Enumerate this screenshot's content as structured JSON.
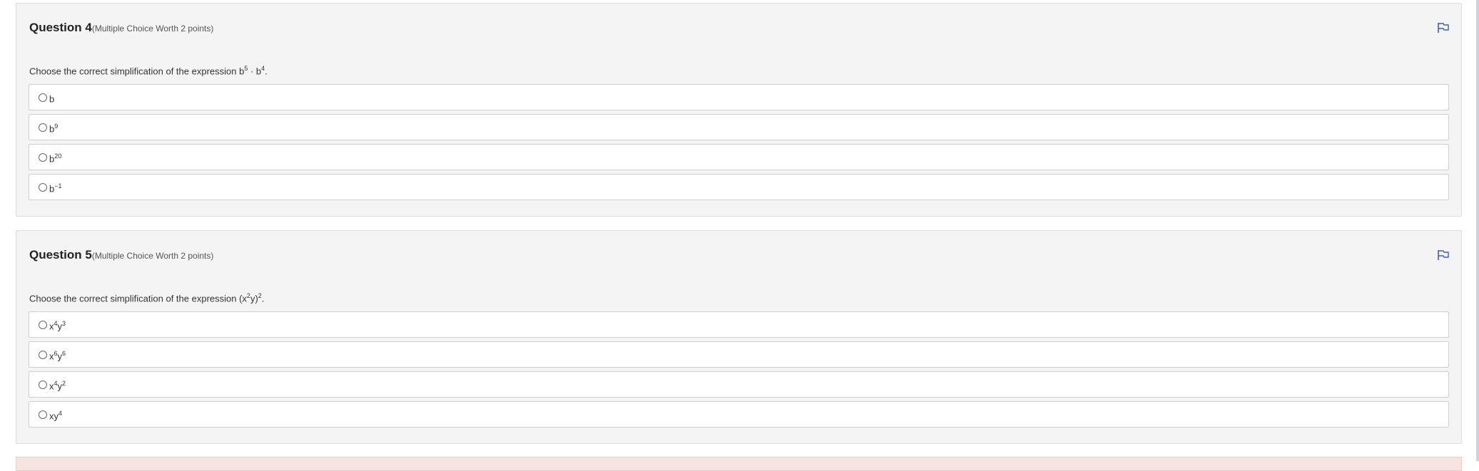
{
  "questions": [
    {
      "title": "Question 4",
      "worth": "(Multiple Choice Worth 2 points)",
      "prompt": {
        "text": "Choose the correct simplification of the expression b",
        "exp1": "5",
        "mid": " · b",
        "exp2": "4",
        "end": "."
      },
      "options": [
        {
          "base": "b",
          "sup": ""
        },
        {
          "base": "b",
          "sup": "9"
        },
        {
          "base": "b",
          "sup": "20"
        },
        {
          "base": "b",
          "sup": "−1"
        }
      ]
    },
    {
      "title": "Question 5",
      "worth": "(Multiple Choice Worth 2 points)",
      "prompt": {
        "text": "Choose the correct simplification of the expression (x",
        "exp1": "2",
        "mid": "y)",
        "exp2": "2",
        "end": "."
      },
      "options": [
        {
          "a": "x",
          "asup": "4",
          "b": "y",
          "bsup": "3"
        },
        {
          "a": "x",
          "asup": "6",
          "b": "y",
          "bsup": "6"
        },
        {
          "a": "x",
          "asup": "4",
          "b": "y",
          "bsup": "2"
        },
        {
          "a": "xy",
          "asup": "4",
          "b": "",
          "bsup": ""
        }
      ]
    }
  ],
  "colors": {
    "card_bg": "#f4f4f4",
    "flag": "#3a5fcd",
    "next_card_bg": "#f5e4e1"
  },
  "icons": {
    "flag": "flag-icon",
    "radio": "radio-icon"
  }
}
